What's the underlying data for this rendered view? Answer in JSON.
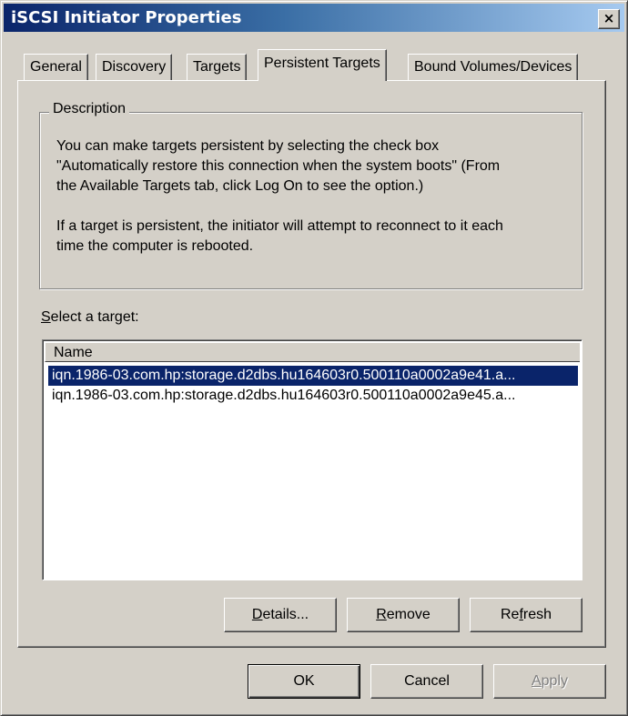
{
  "window": {
    "title": "iSCSI Initiator Properties",
    "close_glyph": "×"
  },
  "tabs": [
    {
      "label": "General"
    },
    {
      "label": "Discovery"
    },
    {
      "label": "Targets"
    },
    {
      "label": "Persistent Targets",
      "active": true
    },
    {
      "label": "Bound Volumes/Devices"
    }
  ],
  "description": {
    "legend": "Description",
    "lines": [
      "You can make targets persistent by selecting the check box",
      "\"Automatically restore this connection when the system boots\" (From",
      "the Available Targets tab, click Log On to see the option.)",
      "If a target is persistent, the initiator will attempt to reconnect to it each",
      "time the computer is rebooted."
    ]
  },
  "target_list": {
    "label_mnemonic": "S",
    "label_rest": "elect a target:",
    "column_header": "Name",
    "items": [
      {
        "name": "iqn.1986-03.com.hp:storage.d2dbs.hu164603r0.500110a0002a9e41.a...",
        "selected": true
      },
      {
        "name": "iqn.1986-03.com.hp:storage.d2dbs.hu164603r0.500110a0002a9e45.a...",
        "selected": false
      }
    ]
  },
  "buttons": {
    "details": {
      "mnemonic": "D",
      "rest": "etails..."
    },
    "remove": {
      "mnemonic": "R",
      "rest": "emove"
    },
    "refresh": {
      "pre": "Re",
      "mnemonic": "f",
      "rest": "resh"
    },
    "ok": "OK",
    "cancel": "Cancel",
    "apply": {
      "mnemonic": "A",
      "rest": "pply",
      "disabled": true
    }
  },
  "colors": {
    "dialog_face": "#d4d0c8",
    "selection": "#0a246a",
    "title_gradient_start": "#0a246a",
    "title_gradient_end": "#a6caf0"
  }
}
